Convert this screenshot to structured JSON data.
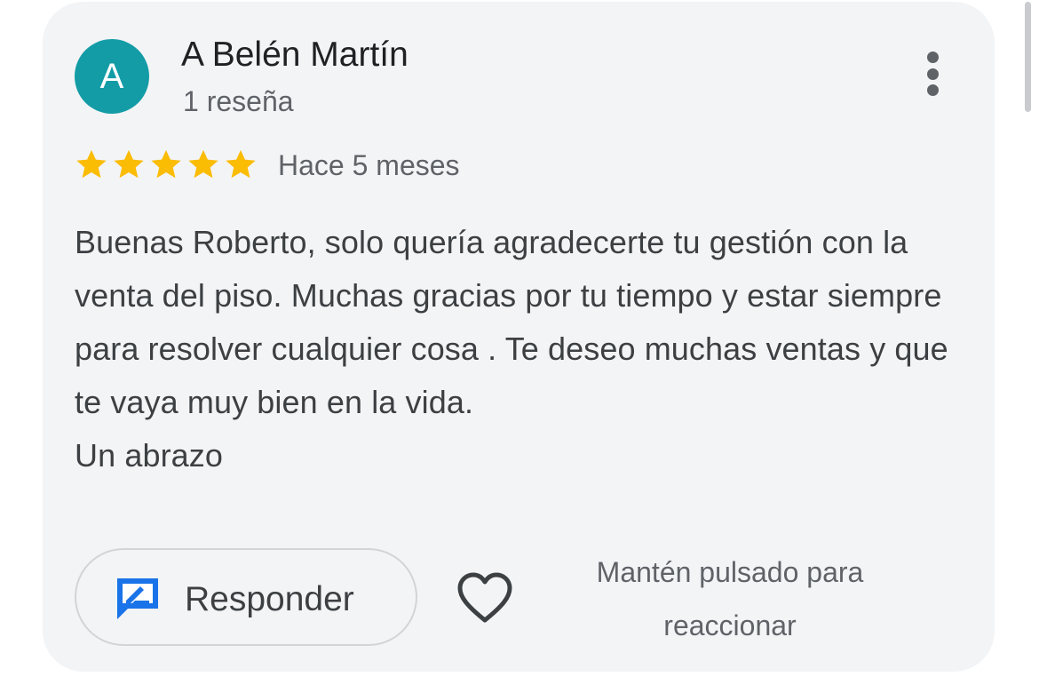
{
  "review": {
    "author": {
      "initial": "A",
      "name": "A Belén Martín",
      "review_count": "1 reseña",
      "avatar_color": "#139ca6"
    },
    "rating": 5,
    "rating_max": 5,
    "star_color": "#fbbc04",
    "date": "Hace 5 meses",
    "text": "Buenas Roberto, solo quería agradecerte tu gestión con la venta del piso. Muchas gracias por tu tiempo y estar siempre para resolver cualquier cosa . Te deseo muchas ventas y que te vaya muy bien en la vida.\nUn abrazo",
    "more_icon": "more-vertical-icon"
  },
  "actions": {
    "reply_label": "Responder",
    "reply_icon": "reply-edit-icon",
    "reply_icon_color": "#1a73e8",
    "like_icon": "heart-outline-icon",
    "react_hint": "Mantén pulsado para reaccionar"
  }
}
